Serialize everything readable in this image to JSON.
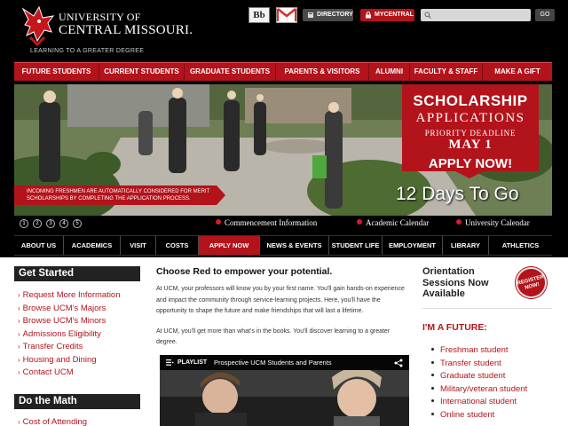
{
  "header": {
    "logo_line1": "UNIVERSITY OF",
    "logo_line2": "CENTRAL MISSOURI.",
    "logo_tagline": "LEARNING TO A GREATER DEGREE",
    "blackboard_label": "Bb",
    "directory_label": "DIRECTORY",
    "mycentral_label": "MYCENTRAL",
    "search_placeholder": "",
    "go_label": "GO"
  },
  "top_nav": [
    {
      "label": "FUTURE STUDENTS"
    },
    {
      "label": "CURRENT STUDENTS"
    },
    {
      "label": "GRADUATE STUDENTS"
    },
    {
      "label": "PARENTS & VISITORS"
    },
    {
      "label": "ALUMNI"
    },
    {
      "label": "FACULTY & STAFF"
    },
    {
      "label": "MAKE A GIFT"
    }
  ],
  "hero": {
    "banner_text": "INCOMING FRESHMEN ARE AUTOMATICALLY CONSIDERED FOR MERIT SCHOLARSHIPS BY COMPLETING THE APPLICATION PROCESS.",
    "promo_line1": "SCHOLARSHIP",
    "promo_line2": "APPLICATIONS",
    "promo_line3": "PRIORITY DEADLINE",
    "promo_line4": "MAY 1",
    "promo_line5": "APPLY NOW!",
    "countdown": "12 Days To Go"
  },
  "slider": {
    "dots": [
      "1",
      "2",
      "3",
      "4",
      "5"
    ],
    "quick_links": [
      {
        "label": "Commencement Information"
      },
      {
        "label": "Academic Calendar"
      },
      {
        "label": "University Calendar"
      }
    ]
  },
  "sub_nav": [
    {
      "label": "ABOUT US"
    },
    {
      "label": "ACADEMICS"
    },
    {
      "label": "VISIT"
    },
    {
      "label": "COSTS"
    },
    {
      "label": "APPLY NOW"
    },
    {
      "label": "NEWS & EVENTS"
    },
    {
      "label": "STUDENT LIFE"
    },
    {
      "label": "EMPLOYMENT"
    },
    {
      "label": "LIBRARY"
    },
    {
      "label": "ATHLETICS"
    }
  ],
  "sidebar": {
    "get_started_title": "Get Started",
    "get_started_links": [
      "Request More Information",
      "Browse UCM's Majors",
      "Browse UCM's Minors",
      "Admissions Eligibility",
      "Transfer Credits",
      "Housing and Dining",
      "Contact UCM"
    ],
    "do_the_math_title": "Do the Math",
    "do_the_math_links": [
      "Cost of Attending"
    ]
  },
  "main": {
    "heading": "Choose Red to empower your potential.",
    "para1": "At UCM, your professors will know you by your first name. You'll gain hands-on experience and impact the community through service-learning projects. Here, you'll have the opportunity to shape the future and make friendships that will last a lifetime.",
    "para2": "At UCM, you'll get more than what's in the books. You'll discover learning to a greater degree.",
    "video": {
      "playlist_label": "PLAYLIST",
      "title": "Prospective UCM Students and Parents"
    }
  },
  "right_col": {
    "orientation_title": "Orientation Sessions Now Available",
    "register_badge": "REGISTER NOW!",
    "future_heading": "I'M A FUTURE:",
    "future_links": [
      "Freshman student",
      "Transfer student",
      "Graduate student",
      "Military/veteran student",
      "International student",
      "Online student"
    ]
  },
  "colors": {
    "brand_red": "#b3131b",
    "black": "#000000"
  }
}
